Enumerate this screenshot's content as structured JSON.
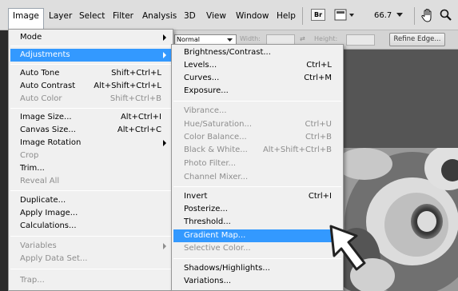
{
  "menubar": {
    "items": [
      {
        "label": "Image",
        "active": true
      },
      {
        "label": "Layer"
      },
      {
        "label": "Select"
      },
      {
        "label": "Filter"
      },
      {
        "label": "Analysis"
      },
      {
        "label": "3D"
      },
      {
        "label": "View"
      },
      {
        "label": "Window"
      },
      {
        "label": "Help"
      }
    ],
    "bridge_label": "Br",
    "zoom": "66.7"
  },
  "options_bar": {
    "style_value": "Normal",
    "width_label": "Width:",
    "height_label": "Height:",
    "refine_edge": "Refine Edge..."
  },
  "image_menu": {
    "items": [
      {
        "label": "Mode",
        "submenu": true
      },
      {
        "label": "Adjustments",
        "submenu": true,
        "highlighted": true
      },
      {
        "label": "Auto Tone",
        "shortcut": "Shift+Ctrl+L"
      },
      {
        "label": "Auto Contrast",
        "shortcut": "Alt+Shift+Ctrl+L"
      },
      {
        "label": "Auto Color",
        "shortcut": "Shift+Ctrl+B",
        "disabled": true
      },
      {
        "label": "Image Size...",
        "shortcut": "Alt+Ctrl+I"
      },
      {
        "label": "Canvas Size...",
        "shortcut": "Alt+Ctrl+C"
      },
      {
        "label": "Image Rotation",
        "submenu": true
      },
      {
        "label": "Crop",
        "disabled": true
      },
      {
        "label": "Trim..."
      },
      {
        "label": "Reveal All",
        "disabled": true
      },
      {
        "label": "Duplicate..."
      },
      {
        "label": "Apply Image..."
      },
      {
        "label": "Calculations..."
      },
      {
        "label": "Variables",
        "submenu": true,
        "disabled": true
      },
      {
        "label": "Apply Data Set...",
        "disabled": true
      },
      {
        "label": "Trap...",
        "disabled": true
      }
    ]
  },
  "adjustments_menu": {
    "items": [
      {
        "label": "Brightness/Contrast..."
      },
      {
        "label": "Levels...",
        "shortcut": "Ctrl+L"
      },
      {
        "label": "Curves...",
        "shortcut": "Ctrl+M"
      },
      {
        "label": "Exposure..."
      },
      {
        "label": "Vibrance...",
        "disabled": true
      },
      {
        "label": "Hue/Saturation...",
        "shortcut": "Ctrl+U",
        "disabled": true
      },
      {
        "label": "Color Balance...",
        "shortcut": "Ctrl+B",
        "disabled": true
      },
      {
        "label": "Black & White...",
        "shortcut": "Alt+Shift+Ctrl+B",
        "disabled": true
      },
      {
        "label": "Photo Filter...",
        "disabled": true
      },
      {
        "label": "Channel Mixer...",
        "disabled": true
      },
      {
        "label": "Invert",
        "shortcut": "Ctrl+I"
      },
      {
        "label": "Posterize..."
      },
      {
        "label": "Threshold..."
      },
      {
        "label": "Gradient Map...",
        "highlighted": true
      },
      {
        "label": "Selective Color...",
        "disabled": true
      },
      {
        "label": "Shadows/Highlights..."
      },
      {
        "label": "Variations..."
      }
    ]
  }
}
